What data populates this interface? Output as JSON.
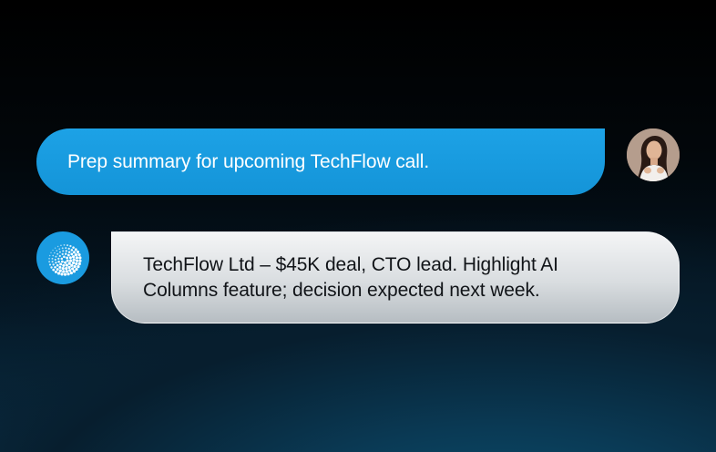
{
  "conversation": {
    "user_message": {
      "text": "Prep summary for upcoming TechFlow call.",
      "avatar_icon": "user-avatar-photo"
    },
    "assistant_message": {
      "lines": [
        "TechFlow Ltd – $45K deal, CTO lead. Highlight AI",
        "Columns feature; decision expected next week."
      ],
      "avatar_icon": "assistant-dots-logo"
    }
  },
  "colors": {
    "accent": "#1a9be0",
    "user_bubble": "#1ca0e4",
    "assistant_bubble": "#e2e5e7",
    "background_top": "#000000",
    "background_bottom": "#0a3650"
  }
}
